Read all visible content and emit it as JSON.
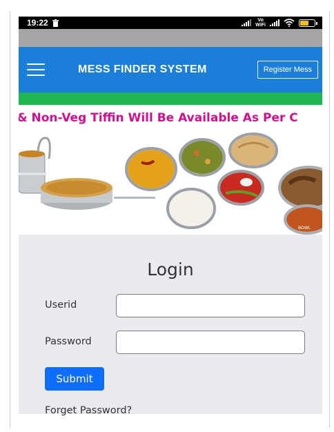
{
  "status_bar": {
    "time": "19:22",
    "vowifi_top": "Vo",
    "vowifi_bottom": "WiFi"
  },
  "navbar": {
    "brand": "MESS FINDER SYSTEM",
    "register_label": "Register Mess"
  },
  "marquee": {
    "text": "i & Non-Veg Tiffin Will Be Available As Per C"
  },
  "banner": {
    "bowl_label": "BOWL"
  },
  "login": {
    "title": "Login",
    "userid_label": "Userid",
    "userid_value": "",
    "password_label": "Password",
    "password_value": "",
    "submit_label": "Submit",
    "forget_label": "Forget Password?"
  },
  "colors": {
    "navbar": "#1b7fd9",
    "green_strip": "#1fb552",
    "marquee_text": "#d10f8e",
    "submit": "#0d6efd",
    "panel": "#e9ebee"
  }
}
